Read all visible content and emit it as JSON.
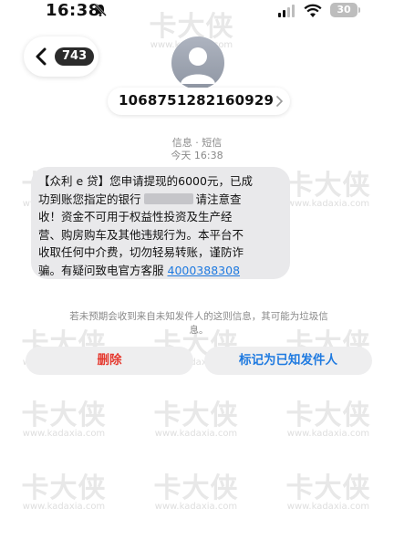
{
  "status_bar": {
    "time": "16:38",
    "battery": "30"
  },
  "header": {
    "unread_count": "743",
    "sender": "1068751282160929"
  },
  "thread": {
    "service_label": "信息 · 短信",
    "timestamp": "今天 16:38"
  },
  "message": {
    "lines": [
      "【众利 e 贷】您申请提现的6000元，已成",
      "收！资金不可用于权益性投资及生产经",
      "营、购房购车及其他违规行为。本平台不",
      "收取任何中介费，切勿轻易转账，谨防诈",
      "骗。有疑问致电官方客服"
    ],
    "line2_before": "功到账您指定的银行",
    "line2_after": "请注意查",
    "phone": "4000388308"
  },
  "notice": "若未预期会收到来自未知发件人的这则信息，其可能为垃圾信息。",
  "actions": {
    "delete_label": "删除",
    "mark_known_label": "标记为已知发件人"
  },
  "watermark": {
    "logo": "卡大侠",
    "url": "www.kadaxia.com"
  },
  "colors": {
    "link_blue": "#1f7ae0",
    "delete_red": "#e5392f",
    "bubble_gray": "#e9e9eb"
  }
}
